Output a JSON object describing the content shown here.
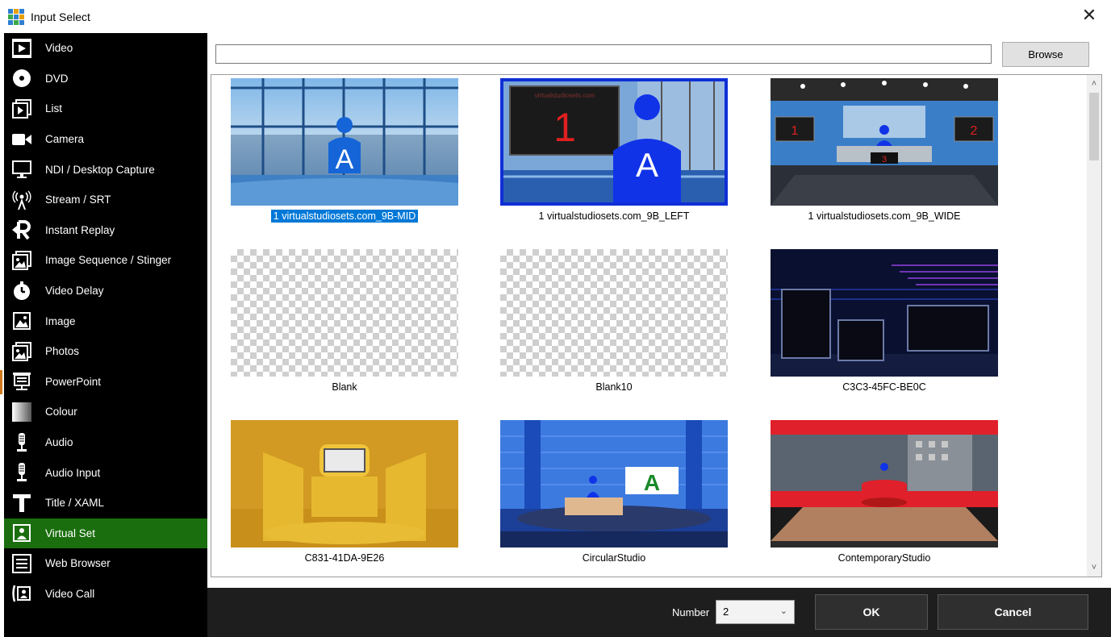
{
  "window": {
    "title": "Input Select",
    "close_glyph": "✕",
    "icon": "app-grid-icon"
  },
  "sidebar": {
    "items": [
      {
        "label": "Video",
        "icon": "video-icon",
        "active": false
      },
      {
        "label": "DVD",
        "icon": "disc-icon",
        "active": false
      },
      {
        "label": "List",
        "icon": "list-icon",
        "active": false
      },
      {
        "label": "Camera",
        "icon": "camera-icon",
        "active": false
      },
      {
        "label": "NDI / Desktop Capture",
        "icon": "monitor-icon",
        "active": false
      },
      {
        "label": "Stream / SRT",
        "icon": "antenna-icon",
        "active": false
      },
      {
        "label": "Instant Replay",
        "icon": "replay-icon",
        "active": false
      },
      {
        "label": "Image Sequence / Stinger",
        "icon": "image-sequence-icon",
        "active": false
      },
      {
        "label": "Video Delay",
        "icon": "timer-icon",
        "active": false
      },
      {
        "label": "Image",
        "icon": "image-icon",
        "active": false
      },
      {
        "label": "Photos",
        "icon": "photos-icon",
        "active": false
      },
      {
        "label": "PowerPoint",
        "icon": "presentation-icon",
        "active": false
      },
      {
        "label": "Colour",
        "icon": "colour-icon",
        "active": false
      },
      {
        "label": "Audio",
        "icon": "microphone-icon",
        "active": false
      },
      {
        "label": "Audio Input",
        "icon": "microphone-icon",
        "active": false
      },
      {
        "label": "Title / XAML",
        "icon": "title-icon",
        "active": false
      },
      {
        "label": "Virtual Set",
        "icon": "virtual-set-icon",
        "active": true
      },
      {
        "label": "Web Browser",
        "icon": "web-browser-icon",
        "active": false
      },
      {
        "label": "Video Call",
        "icon": "video-call-icon",
        "active": false
      }
    ]
  },
  "path_field": {
    "value": ""
  },
  "browse_label": "Browse",
  "tiles": [
    {
      "label": "1 virtualstudiosets.com_9B-MID",
      "selected": true
    },
    {
      "label": "1 virtualstudiosets.com_9B_LEFT",
      "selected": false
    },
    {
      "label": "1 virtualstudiosets.com_9B_WIDE",
      "selected": false
    },
    {
      "label": "Blank",
      "selected": false
    },
    {
      "label": "Blank10",
      "selected": false
    },
    {
      "label": "C3C3-45FC-BE0C",
      "selected": false
    },
    {
      "label": "C831-41DA-9E26",
      "selected": false
    },
    {
      "label": "CircularStudio",
      "selected": false
    },
    {
      "label": "ContemporaryStudio",
      "selected": false
    }
  ],
  "thumbnail_text": {
    "presenter_letter": "A",
    "screen_number_1": "1",
    "screen_number_2": "2",
    "screen_number_3": "3",
    "watermark": "virtualstudiosets.com"
  },
  "scroll": {
    "up_glyph": "˄",
    "down_glyph": "˅"
  },
  "footer": {
    "number_label": "Number",
    "number_value": "2",
    "chevron": "⌄",
    "ok_label": "OK",
    "cancel_label": "Cancel"
  },
  "colors": {
    "sidebar_bg": "#000000",
    "active_bg": "#1a6e0e",
    "selection": "#0078d7",
    "footer_bg": "#1e1e1e",
    "accent": "#d07a1e"
  }
}
